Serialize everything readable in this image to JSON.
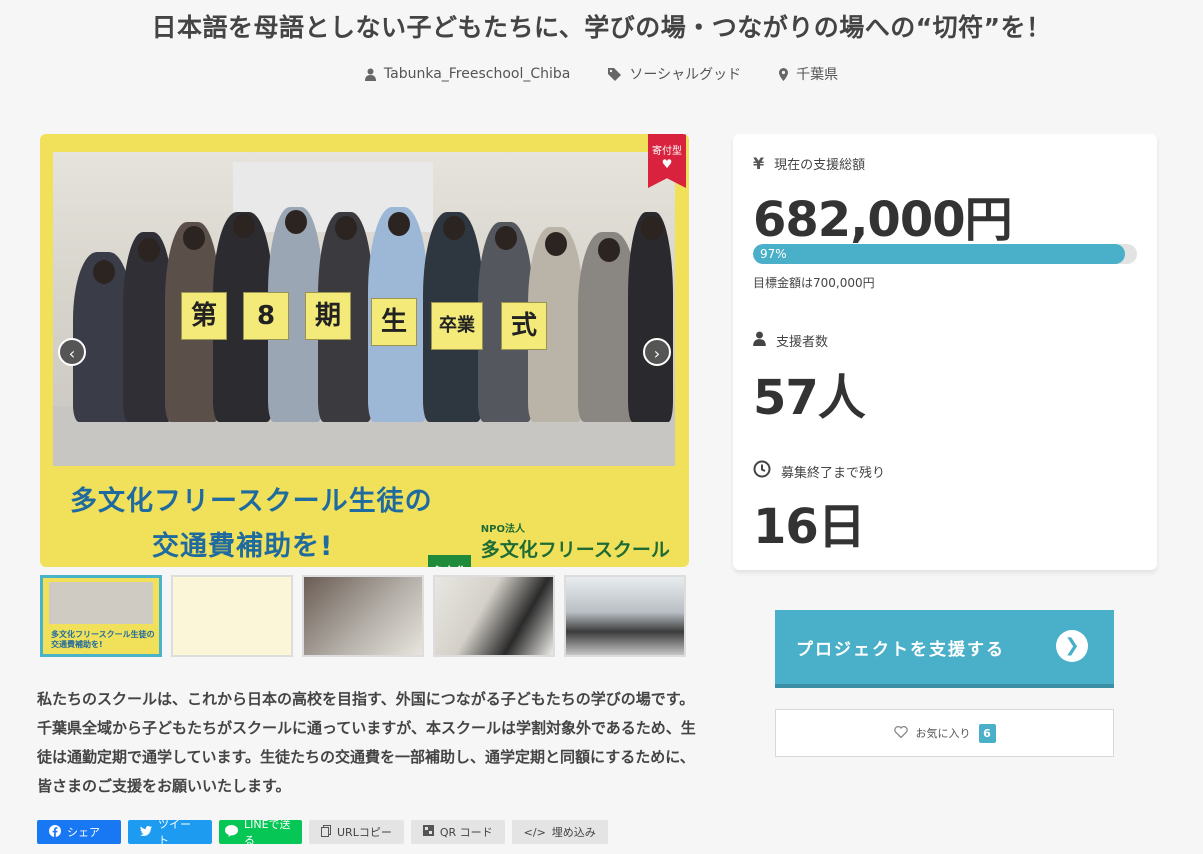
{
  "title": "日本語を母語としない子どもたちに、学びの場・つながりの場への“切符”を！",
  "meta": {
    "owner": "Tabunka_Freeschool_Chiba",
    "category": "ソーシャルグッド",
    "location": "千葉県"
  },
  "gallery": {
    "badge": "寄付型",
    "signs": [
      "第",
      "8",
      "期",
      "生",
      "卒業",
      "式"
    ],
    "banner_line1": "多文化フリースクール生徒の",
    "banner_line2": "交通費補助を!",
    "org_label": "NPO法人",
    "org_name": "多文化フリースクール ちば",
    "logo_text": "多文化",
    "prev_label": "‹",
    "next_label": "›",
    "thumb1_text": "多文化フリースクール生徒の交通費補助を!"
  },
  "description": "私たちのスクールは、これから日本の高校を目指す、外国につながる子どもたちの学びの場です。千葉県全域から子どもたちがスクールに通っていますが、本スクールは学割対象外であるため、生徒は通勤定期で通学しています。生徒たちの交通費を一部補助し、通学定期と同額にするために、皆さまのご支援をお願いいたします。",
  "share": {
    "facebook": "シェア",
    "twitter": "ツイート",
    "line": "LINEで送る",
    "url_copy": "URLコピー",
    "qr": "QR コード",
    "embed": "埋め込み"
  },
  "stats": {
    "total_label": "現在の支援総額",
    "total_value": "682,000円",
    "progress_label": "97%",
    "progress_fraction": 0.97,
    "goal_text": "目標金額は700,000円",
    "supporters_label": "支援者数",
    "supporters_value": "57人",
    "remaining_label": "募集終了まで残り",
    "remaining_value": "16日"
  },
  "support_button": "プロジェクトを支援する",
  "favorite": {
    "label": "お気に入り",
    "count": "6"
  },
  "colors": {
    "accent": "#4aafc8",
    "banner_yellow": "#f0e05a",
    "facebook": "#1877f2",
    "twitter": "#1d9bf0",
    "line": "#06c755",
    "badge_red": "#d8223e"
  },
  "icons": [
    "user-icon",
    "tag-icon",
    "location-pin-icon",
    "yen-icon",
    "clock-icon",
    "heart-icon",
    "chevron-right-icon"
  ]
}
